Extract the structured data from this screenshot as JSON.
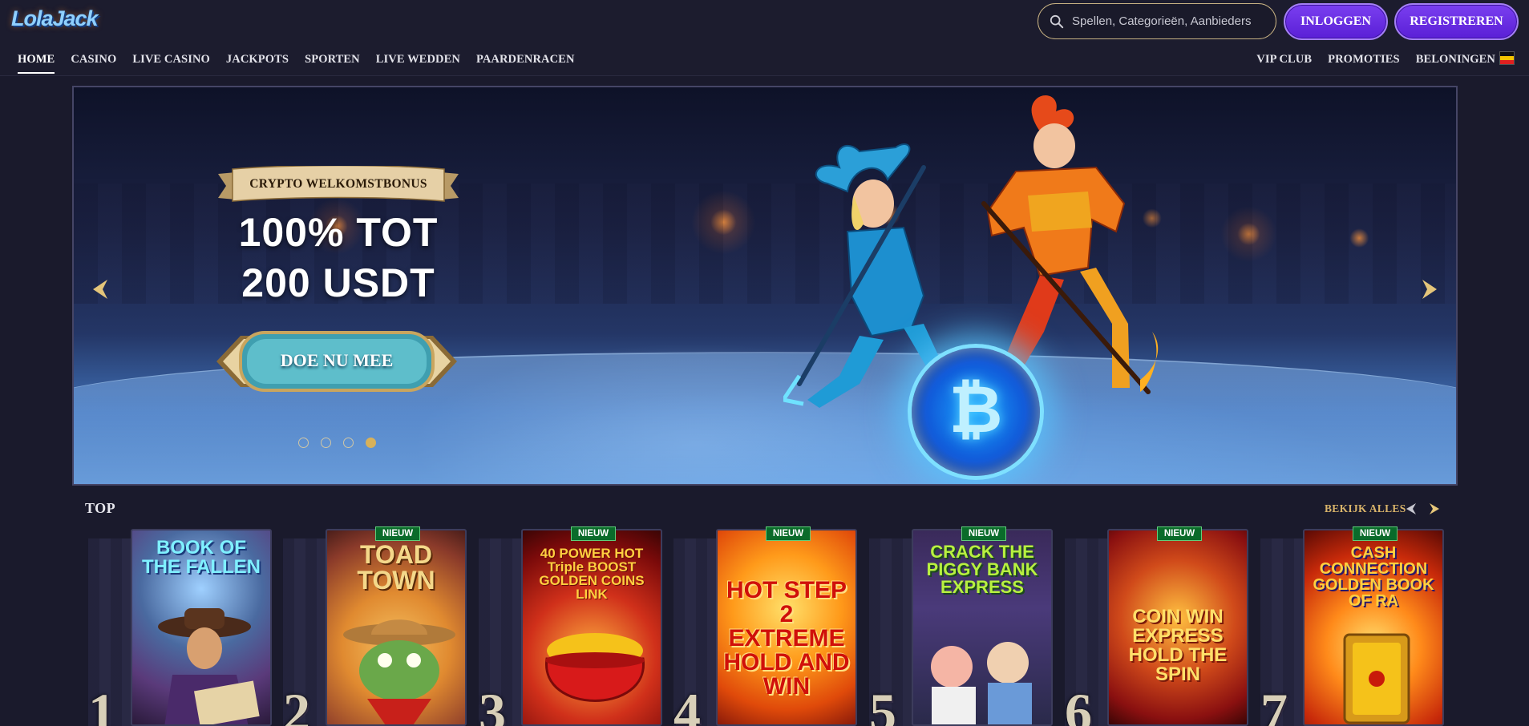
{
  "header": {
    "logo_text": "LolaJack",
    "search_placeholder": "Spellen, Categorieën, Aanbieders",
    "login_label": "INLOGGEN",
    "register_label": "REGISTREREN"
  },
  "nav": {
    "left": [
      "HOME",
      "CASINO",
      "LIVE CASINO",
      "JACKPOTS",
      "SPORTEN",
      "LIVE WEDDEN",
      "PAARDENRACEN"
    ],
    "active": "HOME",
    "right": [
      "VIP CLUB",
      "PROMOTIES",
      "BELONINGEN"
    ]
  },
  "hero": {
    "ribbon": "CRYPTO WELKOMSTBONUS",
    "line1": "100% TOT",
    "line2": "200 USDT",
    "cta": "DOE NU MEE",
    "slide_count": 4,
    "active_slide": 4
  },
  "top_section": {
    "title": "TOP",
    "view_all": "BEKIJK ALLES",
    "new_badge": "NIEUW",
    "games": [
      {
        "rank": "1",
        "title": "BOOK OF THE FALLEN",
        "new": false
      },
      {
        "rank": "2",
        "title": "TOAD TOWN",
        "new": true
      },
      {
        "rank": "3",
        "title": "40 POWER HOT Triple BOOST GOLDEN COINS LINK",
        "new": true
      },
      {
        "rank": "4",
        "title": "HOT STEP 2 EXTREME HOLD AND WIN",
        "new": true
      },
      {
        "rank": "5",
        "title": "CRACK THE PIGGY BANK EXPRESS",
        "new": true
      },
      {
        "rank": "6",
        "title": "COIN WIN EXPRESS HOLD THE SPIN",
        "new": true
      },
      {
        "rank": "7",
        "title": "CASH CONNECTION GOLDEN BOOK OF RA",
        "new": true
      }
    ]
  },
  "colors": {
    "page_bg": "#1a1a2c",
    "button_purple": "#6a2fe6",
    "gold": "#d9b46a",
    "badge_green": "#0a6b2a"
  },
  "icons": {
    "search": "search-icon",
    "prev": "chevron-left-icon",
    "next": "chevron-right-icon",
    "flag": "belgium-flag-icon"
  }
}
